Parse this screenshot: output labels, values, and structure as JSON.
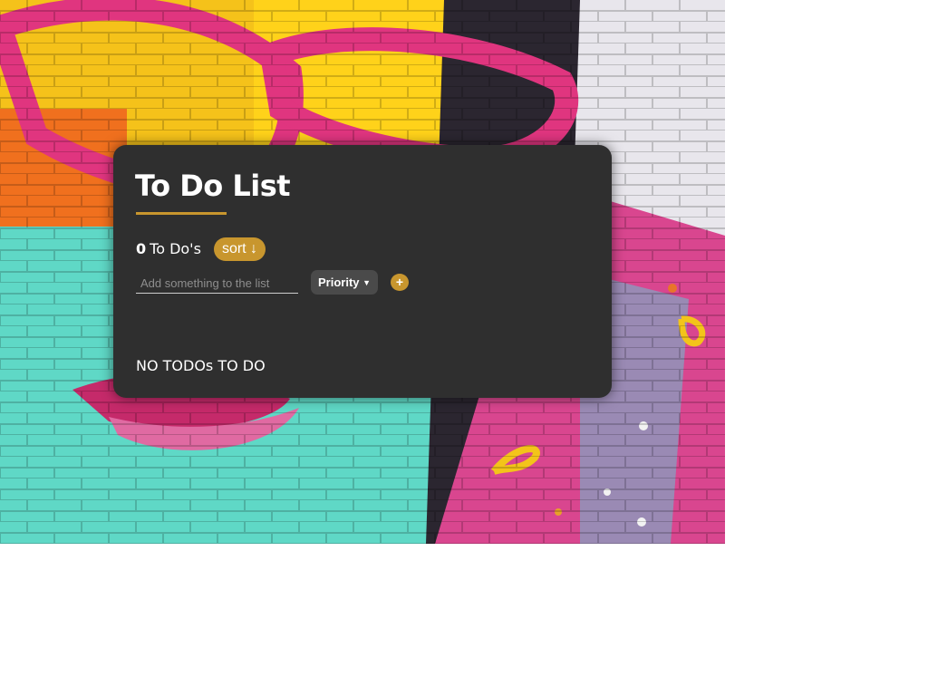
{
  "app": {
    "title": "To Do List"
  },
  "counter": {
    "count": "0",
    "label": "To Do's"
  },
  "sort": {
    "label": "sort ↓"
  },
  "new_todo": {
    "value": "",
    "placeholder": "Add something to the list"
  },
  "priority": {
    "selected": "Priority"
  },
  "add": {
    "label": "+"
  },
  "empty_message": "NO TODOs TO DO",
  "colors": {
    "accent": "#c8962e",
    "card": "#2f2f2f",
    "select": "#4a4a4a"
  }
}
